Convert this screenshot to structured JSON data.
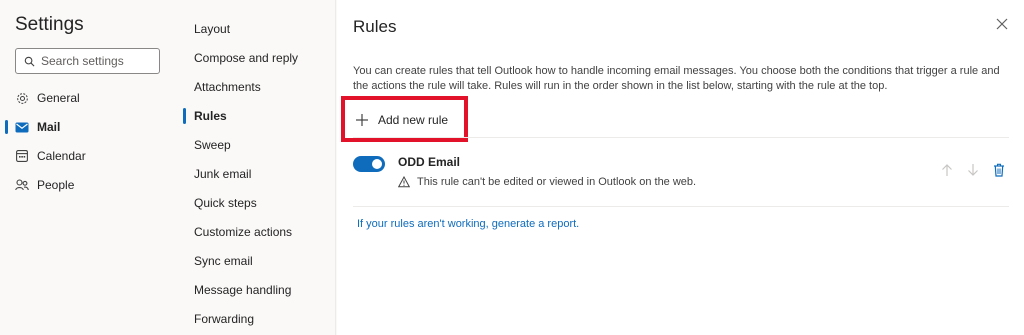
{
  "nav": {
    "title": "Settings",
    "search_placeholder": "Search settings",
    "items": [
      {
        "label": "General",
        "icon": "gear-icon"
      },
      {
        "label": "Mail",
        "icon": "mail-icon"
      },
      {
        "label": "Calendar",
        "icon": "calendar-icon"
      },
      {
        "label": "People",
        "icon": "people-icon"
      }
    ],
    "active_item": "Mail"
  },
  "submenu": {
    "items": [
      "Layout",
      "Compose and reply",
      "Attachments",
      "Rules",
      "Sweep",
      "Junk email",
      "Quick steps",
      "Customize actions",
      "Sync email",
      "Message handling",
      "Forwarding"
    ],
    "active_item": "Rules"
  },
  "main": {
    "title": "Rules",
    "description": "You can create rules that tell Outlook how to handle incoming email messages. You choose both the conditions that trigger a rule and the actions the rule will take. Rules will run in the order shown in the list below, starting with the rule at the top.",
    "add_rule_label": "Add new rule",
    "rules": [
      {
        "name": "ODD Email",
        "enabled": true,
        "warning": "This rule can't be edited or viewed in Outlook on the web."
      }
    ],
    "report_link": "If your rules aren't working, generate a report."
  },
  "colors": {
    "accent": "#0f6cbd",
    "highlight_box": "#e2122a"
  }
}
